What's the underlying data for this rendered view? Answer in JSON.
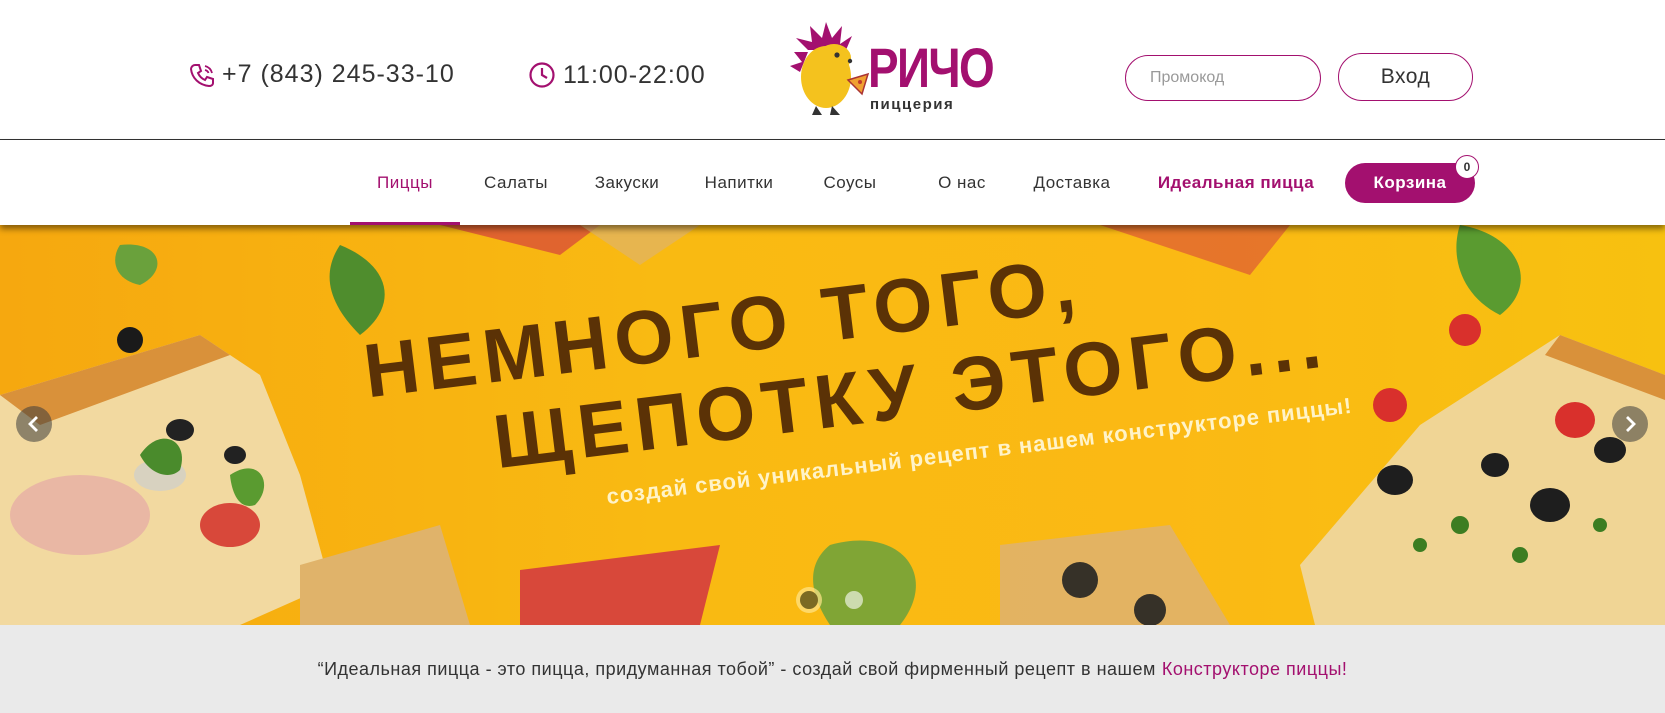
{
  "header": {
    "phone": "+7 (843) 245-33-10",
    "hours": "11:00-22:00",
    "logo": {
      "brand": "РИЧО",
      "subtitle": "пиццерия"
    },
    "promo_placeholder": "Промокод",
    "login_label": "Вход"
  },
  "nav": {
    "items": [
      {
        "label": "Пиццы",
        "active": true
      },
      {
        "label": "Салаты"
      },
      {
        "label": "Закуски"
      },
      {
        "label": "Напитки"
      },
      {
        "label": "Соусы"
      },
      {
        "label": "О нас"
      },
      {
        "label": "Доставка"
      },
      {
        "label": "Идеальная пицца",
        "highlight": true
      }
    ],
    "cart_label": "Корзина",
    "cart_count": "0"
  },
  "banner": {
    "line1": "НЕМНОГО ТОГО,",
    "line2": "ЩЕПОТКУ ЭТОГО...",
    "tagline": "создай свой уникальный рецепт в нашем конструкторе пиццы!",
    "slide_count": 2,
    "active_slide": 1
  },
  "info": {
    "text": "“Идеальная пицца - это пицца, придуманная тобой” - создай свой фирменный рецепт в нашем",
    "link": "Конструкторе пиццы!"
  },
  "colors": {
    "accent": "#a3106f",
    "banner_bg": "#f9b612",
    "headline": "#5b3206",
    "info_bg": "#eaeaea"
  }
}
